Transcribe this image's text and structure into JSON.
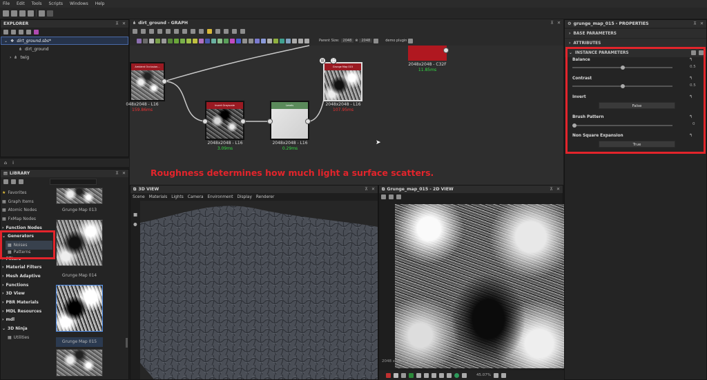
{
  "menu": [
    "File",
    "Edit",
    "Tools",
    "Scripts",
    "Windows",
    "Help"
  ],
  "explorer": {
    "title": "EXPLORER",
    "package": "dirt_ground.sbs*",
    "graph": "dirt_ground",
    "folder": "twig"
  },
  "library": {
    "title": "LIBRARY",
    "search_placeholder": "",
    "items": [
      {
        "label": "Favorites",
        "icon": "star-icon"
      },
      {
        "label": "Graph Items",
        "icon": "graph-icon"
      },
      {
        "label": "Atomic Nodes",
        "icon": "atomic-icon"
      },
      {
        "label": "FxMap Nodes",
        "icon": "fxmap-icon"
      },
      {
        "label": "Function Nodes",
        "icon": "function-icon"
      },
      {
        "label": "Generators",
        "icon": "chevron-down-icon"
      },
      {
        "label": "Noises",
        "icon": "noise-icon"
      },
      {
        "label": "Patterns",
        "icon": "pattern-icon"
      },
      {
        "label": "Filters",
        "icon": "chevron-right-icon"
      },
      {
        "label": "Material Filters",
        "icon": "chevron-right-icon"
      },
      {
        "label": "Mesh Adaptive",
        "icon": "chevron-right-icon"
      },
      {
        "label": "Functions",
        "icon": "chevron-right-icon"
      },
      {
        "label": "3D View",
        "icon": "chevron-right-icon"
      },
      {
        "label": "PBR Materials",
        "icon": "chevron-right-icon"
      },
      {
        "label": "MDL Resources",
        "icon": "chevron-right-icon"
      },
      {
        "label": "mdl",
        "icon": "chevron-right-icon"
      },
      {
        "label": "3D Ninja",
        "icon": "chevron-down-icon"
      },
      {
        "label": "Utilities",
        "icon": "utility-icon"
      }
    ],
    "thumbs": [
      "Grunge Map 013",
      "Grunge Map 014",
      "Grunge Map 015"
    ]
  },
  "graph": {
    "title": "dirt_ground - GRAPH",
    "parent_size_label": "Parent Size:",
    "parent_size": "2048",
    "size2": "2048",
    "plugin": "demo plugin",
    "nodes": [
      {
        "title": "Ambient Occlusion...",
        "size": "048x2048 - L16",
        "time": "159.86ms"
      },
      {
        "title": "Grunge Map 015",
        "size": "2048x2048 - L16",
        "time": "107.95ms"
      },
      {
        "title": "",
        "size": "2048x2048 - C32F",
        "time": "11.85ms"
      },
      {
        "title": "Invert Grayscale",
        "size": "2048x2048 - L16",
        "time": "3.09ms"
      },
      {
        "title": "Levels",
        "size": "2048x2048 - L16",
        "time": "0.29ms"
      }
    ]
  },
  "caption": "Roughness determines how much light a surface scatters.",
  "view3d": {
    "title": "3D VIEW",
    "menu": [
      "Scene",
      "Materials",
      "Lights",
      "Camera",
      "Environment",
      "Display",
      "Renderer"
    ]
  },
  "view2d": {
    "title": "Grunge_map_015 - 2D VIEW",
    "info": "2048 x 2048 (Grayscale, 16bpc)",
    "zoom": "45.07%"
  },
  "properties": {
    "title": "grunge_map_015 - PROPERTIES",
    "sections": [
      "BASE PARAMETERS",
      "ATTRIBUTES",
      "INSTANCE PARAMETERS"
    ],
    "params": [
      {
        "name": "Balance",
        "value": "0.5",
        "level": 0.5
      },
      {
        "name": "Contrast",
        "value": "0.5",
        "level": 0.5
      },
      {
        "name": "Invert",
        "button": "False"
      },
      {
        "name": "Brush Pattern",
        "value": "0",
        "level": 0
      },
      {
        "name": "Non Square Expansion",
        "button": "True"
      }
    ]
  },
  "colors": {
    "accent_red": "#e3242b",
    "time_green": "#33dd44",
    "time_red": "#ee3333"
  }
}
